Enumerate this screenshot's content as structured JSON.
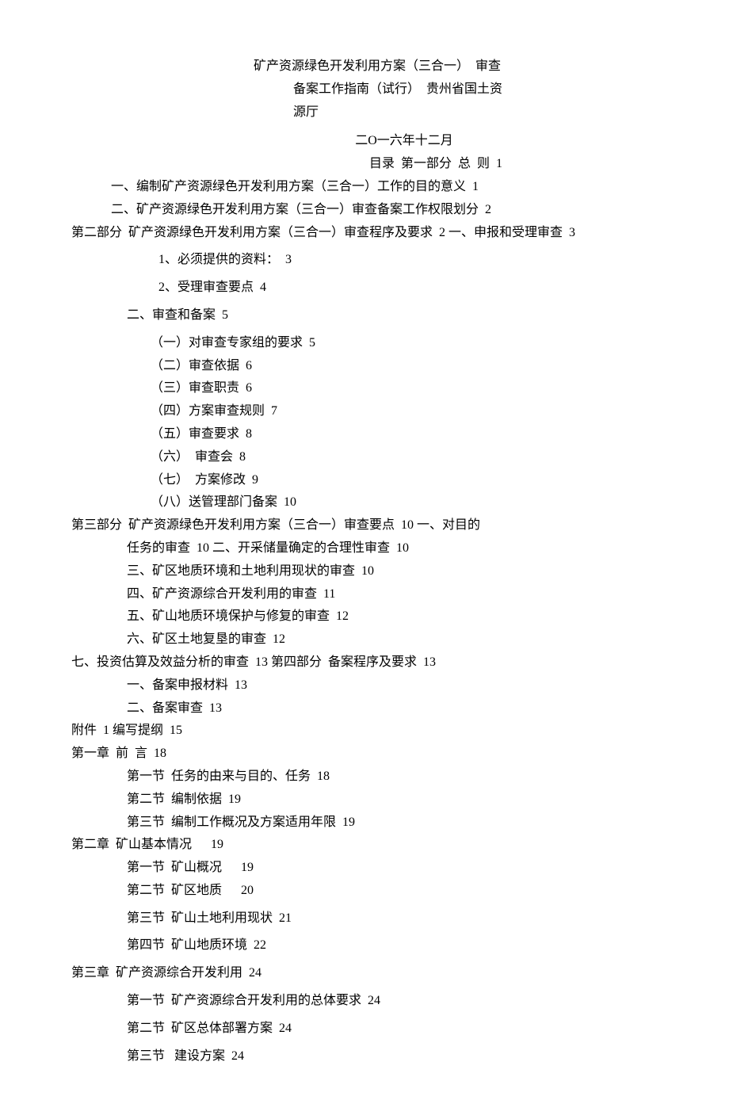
{
  "title": {
    "line1": "矿产资源绿色开发利用方案（三合一）  审查",
    "line2": "备案工作指南（试行）  贵州省国土资",
    "line3": "源厅"
  },
  "date": "二O一六年十二月",
  "toc_header": "目录  第一部分  总  则  1",
  "lines": [
    {
      "cls": "indent-1",
      "text": "一、编制矿产资源绿色开发利用方案（三合一）工作的目的意义  1"
    },
    {
      "cls": "indent-1",
      "text": "二、矿产资源绿色开发利用方案（三合一）审查备案工作权限划分  2"
    },
    {
      "cls": "no-indent",
      "text": "第二部分  矿产资源绿色开发利用方案（三合一）审查程序及要求  2 一、申报和受理审查  3"
    },
    {
      "cls": "indent-2 spaced",
      "text": "1、必须提供的资料：  3"
    },
    {
      "cls": "indent-2 spaced",
      "text": "2、受理审查要点  4"
    },
    {
      "cls": "indent-section spaced",
      "text": "二、审查和备案  5"
    },
    {
      "cls": "indent-2b",
      "text": "（一）对审查专家组的要求  5"
    },
    {
      "cls": "indent-2b",
      "text": "（二）审查依据  6"
    },
    {
      "cls": "indent-2b",
      "text": "（三）审查职责  6"
    },
    {
      "cls": "indent-2b",
      "text": "（四）方案审查规则  7"
    },
    {
      "cls": "indent-2b",
      "text": "（五）审查要求  8"
    },
    {
      "cls": "indent-2b",
      "text": "（六）  审查会  8"
    },
    {
      "cls": "indent-2b",
      "text": "（七）  方案修改  9"
    },
    {
      "cls": "indent-2b",
      "text": "（八）送管理部门备案  10"
    },
    {
      "cls": "no-indent",
      "text": "第三部分  矿产资源绿色开发利用方案（三合一）审查要点  10 一、对目的"
    },
    {
      "cls": "indent-section",
      "text": "任务的审查  10 二、开采储量确定的合理性审查  10"
    },
    {
      "cls": "indent-section",
      "text": "三、矿区地质环境和土地利用现状的审查  10"
    },
    {
      "cls": "indent-section",
      "text": "四、矿产资源综合开发利用的审查  11"
    },
    {
      "cls": "indent-section",
      "text": "五、矿山地质环境保护与修复的审查  12"
    },
    {
      "cls": "indent-section",
      "text": "六、矿区土地复垦的审查  12"
    },
    {
      "cls": "no-indent",
      "text": "七、投资估算及效益分析的审查  13 第四部分  备案程序及要求  13"
    },
    {
      "cls": "indent-section",
      "text": "一、备案申报材料  13"
    },
    {
      "cls": "indent-section",
      "text": "二、备案审查  13"
    },
    {
      "cls": "no-indent",
      "text": "附件  1 编写提纲  15"
    },
    {
      "cls": "no-indent",
      "text": "第一章  前  言  18"
    },
    {
      "cls": "indent-section",
      "text": "第一节  任务的由来与目的、任务  18"
    },
    {
      "cls": "indent-section",
      "text": "第二节  编制依据  19"
    },
    {
      "cls": "indent-section",
      "text": "第三节  编制工作概况及方案适用年限  19"
    },
    {
      "cls": "no-indent",
      "text": "第二章  矿山基本情况      19"
    },
    {
      "cls": "indent-section",
      "text": "第一节  矿山概况      19"
    },
    {
      "cls": "indent-section",
      "text": "第二节  矿区地质      20"
    },
    {
      "cls": "indent-section spaced",
      "text": "第三节  矿山土地利用现状  21"
    },
    {
      "cls": "indent-section spaced",
      "text": "第四节  矿山地质环境  22"
    },
    {
      "cls": "no-indent spaced",
      "text": "第三章  矿产资源综合开发利用  24"
    },
    {
      "cls": "indent-section spaced",
      "text": "第一节  矿产资源综合开发利用的总体要求  24"
    },
    {
      "cls": "indent-section spaced",
      "text": "第二节  矿区总体部署方案  24"
    },
    {
      "cls": "indent-section spaced",
      "text": "第三节   建设方案  24"
    }
  ]
}
